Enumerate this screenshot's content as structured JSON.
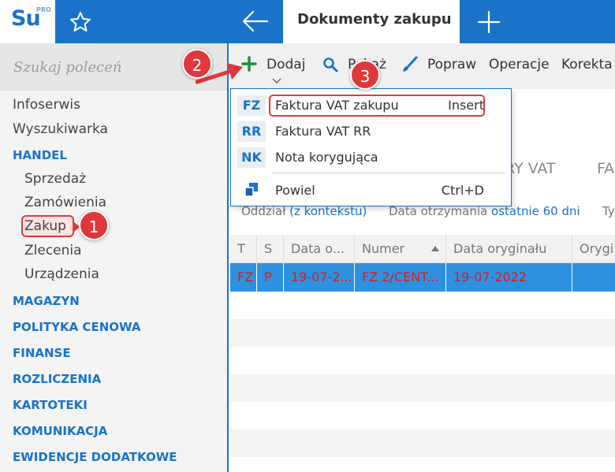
{
  "header": {
    "logo": {
      "text": "Su",
      "badge": "PRO"
    },
    "active_tab": "Dokumenty zakupu"
  },
  "sidebar": {
    "search_placeholder": "Szukaj poleceń",
    "items": [
      {
        "label": "Infoserwis"
      },
      {
        "label": "Wyszukiwarka"
      }
    ],
    "handel": {
      "label": "HANDEL",
      "children": [
        "Sprzedaż",
        "Zamówienia",
        "Zakup",
        "Zlecenia",
        "Urządzenia"
      ]
    },
    "sections": [
      "MAGAZYN",
      "POLITYKA CENOWA",
      "FINANSE",
      "ROZLICZENIA",
      "KARTOTEKI",
      "KOMUNIKACJA",
      "EWIDENCJE DODATKOWE"
    ]
  },
  "toolbar": {
    "add": "Dodaj",
    "show": "Pokaż",
    "edit": "Popraw",
    "operations": "Operacje",
    "correction": "Korekta"
  },
  "dropdown": {
    "items": [
      {
        "code": "FZ",
        "label": "Faktura VAT zakupu",
        "shortcut": "Insert"
      },
      {
        "code": "RR",
        "label": "Faktura VAT RR",
        "shortcut": ""
      },
      {
        "code": "NK",
        "label": "Nota korygująca",
        "shortcut": ""
      },
      {
        "code": "",
        "label": "Powiel",
        "shortcut": "Ctrl+D"
      }
    ]
  },
  "tabs_behind": [
    "RY VAT",
    "FA"
  ],
  "filters": {
    "branch_label": "Oddział",
    "branch_value": "(z kontekstu)",
    "date_label": "Data otrzymania",
    "date_value": "ostatnie 60 dni",
    "type_label": "Ty"
  },
  "table": {
    "columns": [
      "T",
      "S",
      "Data o...",
      "Numer",
      "Data oryginału",
      "Orygi"
    ],
    "rows": [
      [
        "FZ",
        "P",
        "19-07-2...",
        "FZ 2/CENT...",
        "19-07-2022",
        ""
      ]
    ]
  },
  "badges": [
    "1",
    "2",
    "3"
  ],
  "colors": {
    "brand_blue": "#1a73c9",
    "highlight_red": "#e03a3a",
    "selected_row": "#2e91e0",
    "row_text_red": "#d41f1f"
  }
}
